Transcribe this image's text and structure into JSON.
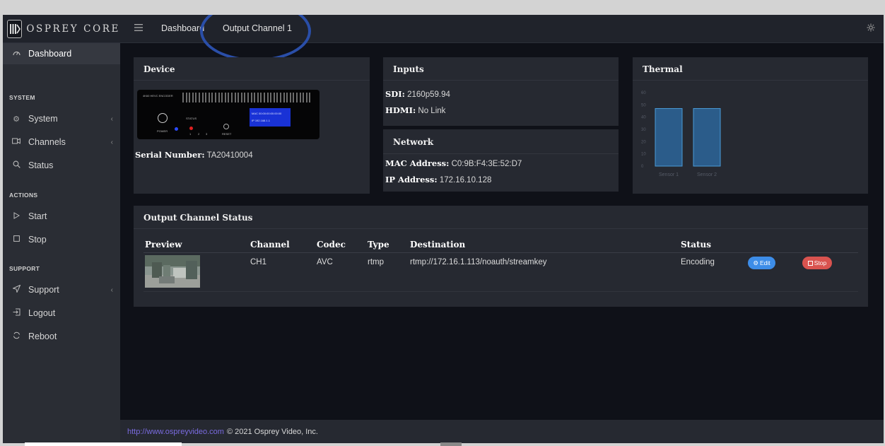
{
  "brand": {
    "logo_text": "OSPREY CORE"
  },
  "header": {
    "menu_icon": "hamburger-icon",
    "links": [
      "Dashboard",
      "Output Channel 1"
    ],
    "settings_icon": "gear-icon"
  },
  "sidebar": {
    "items": [
      {
        "label": "Dashboard",
        "icon": "gauge-icon"
      },
      {
        "label": "System",
        "icon": "gear-icon"
      },
      {
        "label": "Channels",
        "icon": "video-icon"
      },
      {
        "label": "Status",
        "icon": "magnifier-icon"
      },
      {
        "label": "Start",
        "icon": "play-icon"
      },
      {
        "label": "Stop",
        "icon": "stop-icon"
      },
      {
        "label": "Support",
        "icon": "send-icon"
      },
      {
        "label": "Logout",
        "icon": "logout-icon"
      },
      {
        "label": "Reboot",
        "icon": "reboot-icon"
      }
    ],
    "sections": [
      "SYSTEM",
      "ACTIONS",
      "SUPPORT"
    ]
  },
  "device": {
    "title": "Device",
    "serial_label": "Serial Number:",
    "serial_value": "TA20410004",
    "image": {
      "model": "4K60 HEVC ENCODER",
      "status": "STATUS",
      "power": "POWER",
      "leds": [
        "1",
        "2",
        "3"
      ],
      "reset": "RESET",
      "screen_mac": "MAC 00:00:00:00:00:00",
      "screen_ip": "IP  192.168.1.1"
    }
  },
  "inputs": {
    "title": "Inputs",
    "sdi_label": "SDI:",
    "sdi_value": "2160p59.94",
    "hdmi_label": "HDMI:",
    "hdmi_value": "No Link"
  },
  "network": {
    "title": "Network",
    "mac_label": "MAC Address:",
    "mac_value": "C0:9B:F4:3E:52:D7",
    "ip_label": "IP Address:",
    "ip_value": "172.16.10.128"
  },
  "thermal": {
    "title": "Thermal"
  },
  "chart_data": {
    "type": "bar",
    "categories": [
      "Sensor 1",
      "Sensor 2"
    ],
    "values": [
      47,
      47
    ],
    "ylim": [
      0,
      60
    ],
    "yticks": [
      0,
      10,
      20,
      30,
      40,
      50,
      60
    ],
    "grid": false,
    "bar_color": "#2b5c8a",
    "bar_edge_color": "#4a9ad6"
  },
  "output_status": {
    "title": "Output Channel Status",
    "columns": [
      "Preview",
      "Channel",
      "Codec",
      "Type",
      "Destination",
      "Status"
    ],
    "rows": [
      {
        "channel": "CH1",
        "codec": "AVC",
        "type": "rtmp",
        "destination": "rtmp://172.16.1.113/noauth/streamkey",
        "status": "Encoding",
        "edit_label": "Edit",
        "stop_label": "Stop"
      }
    ]
  },
  "footer": {
    "link": "http://www.ospreyvideo.com",
    "text": "© 2021 Osprey Video, Inc."
  },
  "colors": {
    "accent_blue": "#3d8de8",
    "stop_red": "#d9534f",
    "highlight_ring": "#2a4ea8",
    "footer_link": "#7a6be0"
  }
}
